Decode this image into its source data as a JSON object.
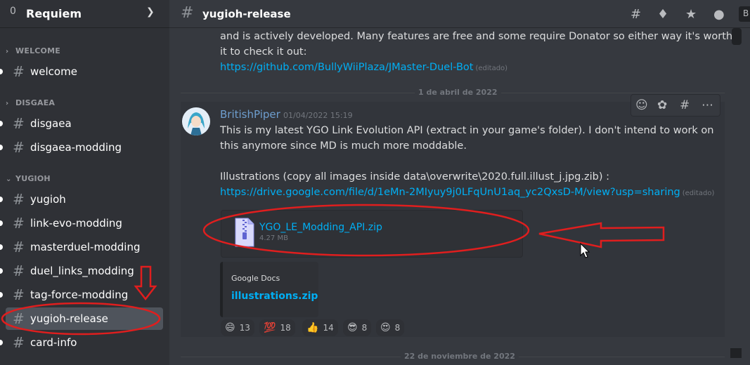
{
  "server": {
    "name": "Requiem",
    "pip": "0"
  },
  "categories": [
    {
      "label": "WELCOME",
      "channels": [
        {
          "label": "welcome",
          "unread": true
        }
      ]
    },
    {
      "label": "DISGAEA",
      "channels": [
        {
          "label": "disgaea",
          "unread": true
        },
        {
          "label": "disgaea-modding",
          "unread": true
        }
      ]
    },
    {
      "label": "YUGIOH",
      "channels": [
        {
          "label": "yugioh",
          "unread": true
        },
        {
          "label": "link-evo-modding",
          "unread": true
        },
        {
          "label": "masterduel-modding",
          "unread": true
        },
        {
          "label": "duel_links_modding",
          "unread": true
        },
        {
          "label": "tag-force-modding",
          "unread": true
        },
        {
          "label": "yugioh-release",
          "unread": false,
          "active": true
        },
        {
          "label": "card-info",
          "unread": true
        }
      ]
    }
  ],
  "header": {
    "channel_name": "yugioh-release",
    "search_stub": "B"
  },
  "prev_message": {
    "line1": "and is actively developed. Many features are free and some require Donator so either way it's worth",
    "line2": "it to check it out:",
    "link": "https://github.com/BullyWiiPlaza/JMaster-Duel-Bot",
    "edited": "(editado)"
  },
  "date_divider_1": "1 de abril de 2022",
  "date_divider_2": "22 de noviembre de 2022",
  "message": {
    "author": "BritishPiper",
    "timestamp": "01/04/2022 15:19",
    "line1": "This is my latest YGO Link Evolution API (extract in your game's folder). I don't intend to work on",
    "line2": "this anymore since MD is much more moddable.",
    "line3": "Illustrations (copy all images inside data\\overwrite\\2020.full.illust_j.jpg.zib) :",
    "link": "https://drive.google.com/file/d/1eMn-2MIyuy9j0LFqUnU1aq_yc2QxsD-M/view?usp=sharing",
    "edited": "(editado)",
    "attachment": {
      "name": "YGO_LE_Modding_API.zip",
      "size": "4.27 MB"
    },
    "embed": {
      "provider": "Google Docs",
      "title": "illustrations.zip"
    },
    "reactions": [
      {
        "emoji": "😄",
        "count": "13"
      },
      {
        "emoji": "💯",
        "count": "18"
      },
      {
        "emoji": "👍",
        "count": "14"
      },
      {
        "emoji": "😎",
        "count": "8"
      },
      {
        "emoji": "😍",
        "count": "8"
      }
    ]
  },
  "colors": {
    "accent_link": "#00aff4",
    "annotation": "#e01e1e",
    "author": "#6e9ecf"
  }
}
